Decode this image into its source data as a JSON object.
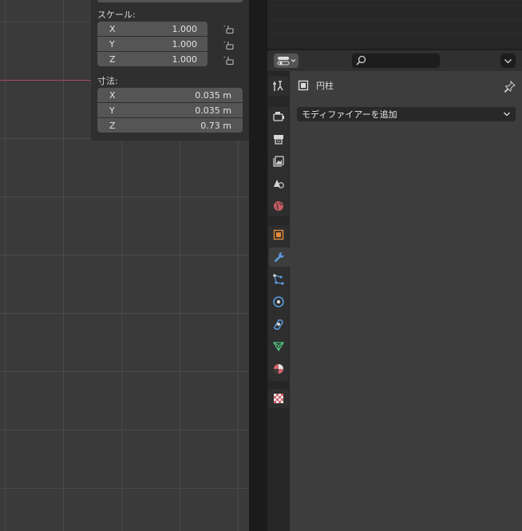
{
  "sidebar": {
    "scale_label": "スケール:",
    "scale": [
      {
        "axis": "X",
        "value": "1.000"
      },
      {
        "axis": "Y",
        "value": "1.000"
      },
      {
        "axis": "Z",
        "value": "1.000"
      }
    ],
    "dimensions_label": "寸法:",
    "dimensions": [
      {
        "axis": "X",
        "value": "0.035 m"
      },
      {
        "axis": "Y",
        "value": "0.035 m"
      },
      {
        "axis": "Z",
        "value": "0.73 m"
      }
    ]
  },
  "properties": {
    "object_name": "円柱",
    "add_modifier_label": "モディファイアーを追加",
    "active_tab": "modifiers",
    "tabs": [
      "tool",
      "render",
      "output",
      "view-layer",
      "scene",
      "world",
      "object",
      "modifiers",
      "particles",
      "physics",
      "constraints",
      "data",
      "material",
      "texture"
    ]
  },
  "colors": {
    "accent_blue": "#4772b3",
    "object_orange": "#e38a3a",
    "x_axis_red": "#a94a5c",
    "data_green": "#4fbf7c",
    "material_red": "#d2646c"
  }
}
